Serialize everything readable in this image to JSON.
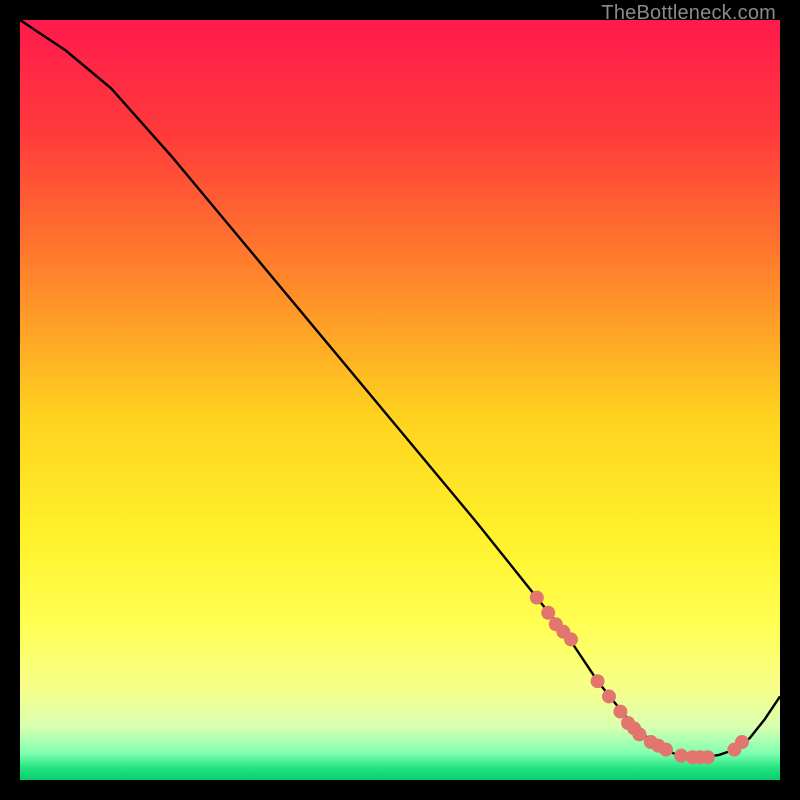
{
  "attribution": "TheBottleneck.com",
  "chart_data": {
    "type": "line",
    "title": "",
    "xlabel": "",
    "ylabel": "",
    "xlim": [
      0,
      100
    ],
    "ylim": [
      0,
      100
    ],
    "series": [
      {
        "name": "curve",
        "x": [
          0,
          6,
          12,
          20,
          30,
          40,
          50,
          60,
          68,
          72,
          76,
          80,
          82,
          84,
          86,
          88,
          90,
          92,
          94,
          96,
          98,
          100
        ],
        "y": [
          100,
          96,
          91,
          82,
          70,
          58,
          46,
          34,
          24,
          19,
          13,
          8,
          6,
          4.5,
          3.5,
          3,
          3,
          3.3,
          4,
          5.5,
          8,
          11
        ]
      }
    ],
    "markers": {
      "name": "highlight-points",
      "x": [
        68,
        69.5,
        70.5,
        71.5,
        72.5,
        76,
        77.5,
        79,
        80,
        80.8,
        81.5,
        83,
        84,
        85,
        87,
        88.5,
        89.5,
        90.5,
        94,
        95
      ],
      "y": [
        24,
        22,
        20.5,
        19.5,
        18.5,
        13,
        11,
        9,
        7.5,
        6.8,
        6,
        5,
        4.5,
        4,
        3.2,
        3,
        3,
        3,
        4,
        5
      ]
    },
    "background_gradient": {
      "stops": [
        {
          "offset": 0.0,
          "color": "#ff1a4d"
        },
        {
          "offset": 0.15,
          "color": "#ff3a3a"
        },
        {
          "offset": 0.35,
          "color": "#ff8a2a"
        },
        {
          "offset": 0.52,
          "color": "#ffd21f"
        },
        {
          "offset": 0.68,
          "color": "#fff22a"
        },
        {
          "offset": 0.8,
          "color": "#ffff55"
        },
        {
          "offset": 0.88,
          "color": "#f6ff8a"
        },
        {
          "offset": 0.93,
          "color": "#d8ffb0"
        },
        {
          "offset": 0.965,
          "color": "#7fffb0"
        },
        {
          "offset": 0.985,
          "color": "#20e27f"
        },
        {
          "offset": 1.0,
          "color": "#0acc6e"
        }
      ]
    },
    "curve_color": "#000000",
    "marker_color": "#e2766e",
    "marker_radius_px": 7
  }
}
